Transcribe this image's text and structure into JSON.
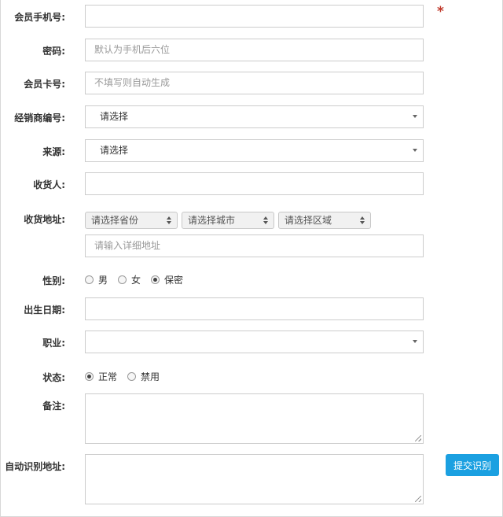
{
  "form": {
    "phone": {
      "label": "会员手机号:",
      "value": "",
      "placeholder": ""
    },
    "required_mark": "*",
    "password": {
      "label": "密码:",
      "placeholder": "默认为手机后六位"
    },
    "member_card": {
      "label": "会员卡号:",
      "placeholder": "不填写则自动生成"
    },
    "dealer": {
      "label": "经销商编号:",
      "selected": "请选择"
    },
    "source": {
      "label": "来源:",
      "selected": "请选择"
    },
    "receiver": {
      "label": "收货人:",
      "value": ""
    },
    "address": {
      "label": "收货地址:",
      "province": "请选择省份",
      "city": "请选择城市",
      "district": "请选择区域",
      "detail_placeholder": "请输入详细地址"
    },
    "gender": {
      "label": "性别:",
      "options": [
        "男",
        "女",
        "保密"
      ],
      "selected": "保密"
    },
    "birthday": {
      "label": "出生日期:",
      "value": ""
    },
    "occupation": {
      "label": "职业:",
      "selected": ""
    },
    "status": {
      "label": "状态:",
      "options": [
        "正常",
        "禁用"
      ],
      "selected": "正常"
    },
    "remark": {
      "label": "备注:",
      "value": ""
    },
    "auto_address": {
      "label": "自动识别地址:",
      "value": ""
    },
    "submit_label": "提交识别"
  }
}
